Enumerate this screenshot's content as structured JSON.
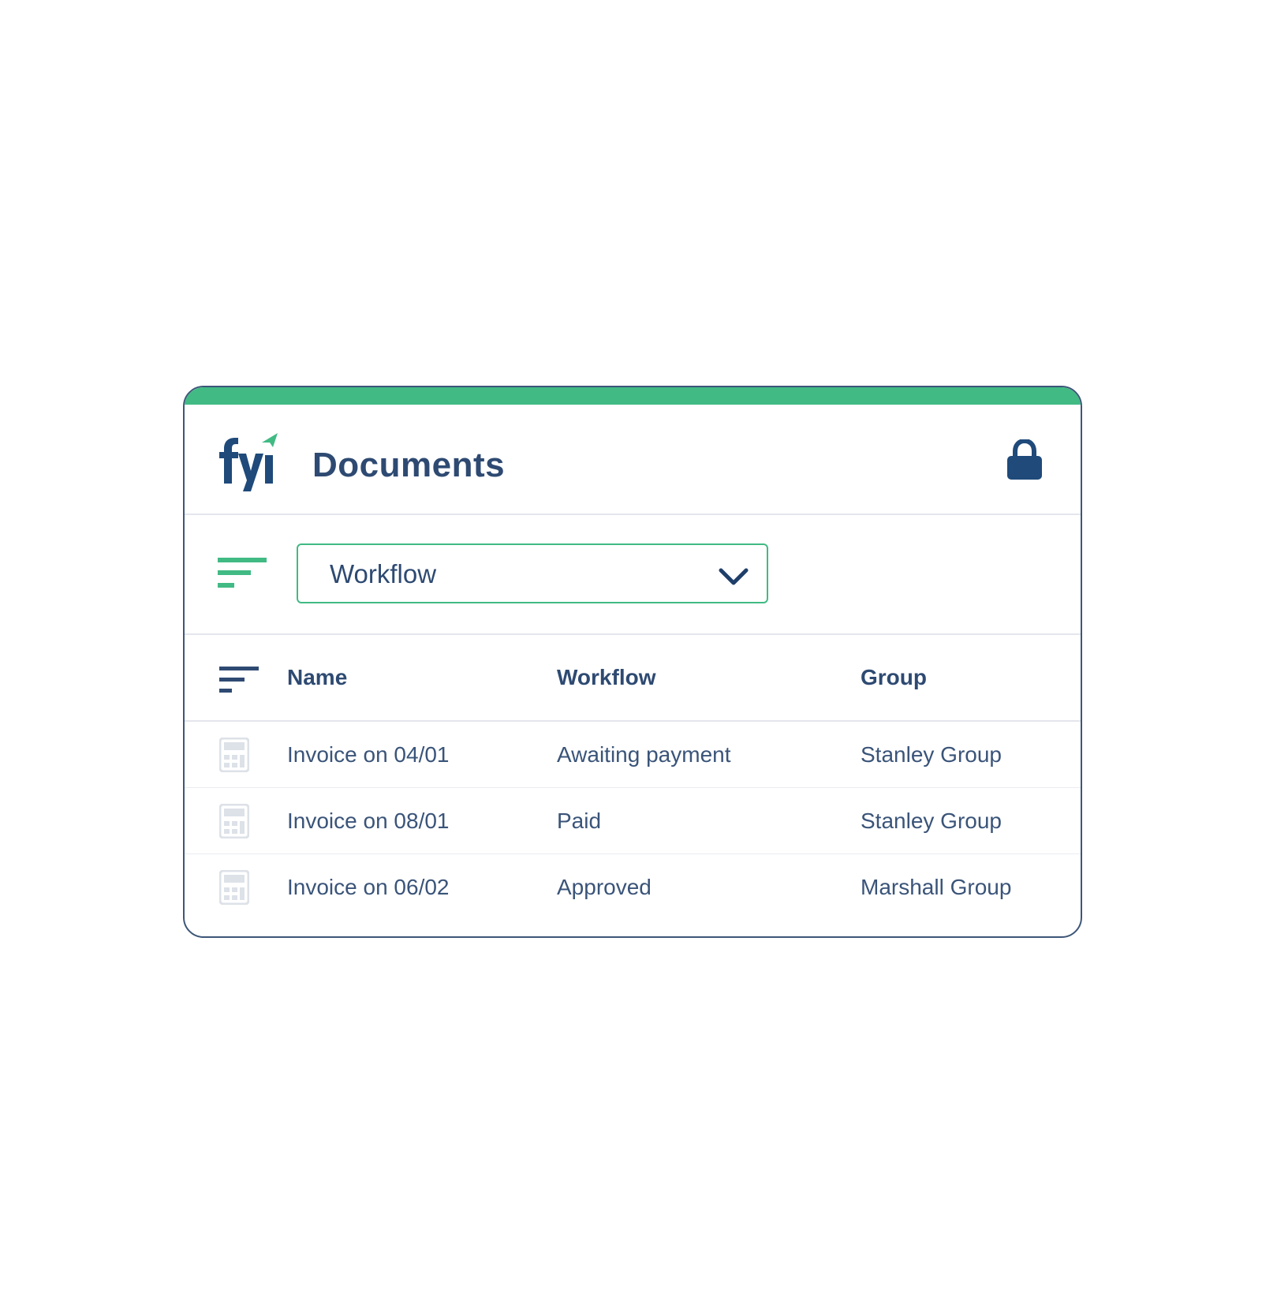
{
  "header": {
    "title": "Documents",
    "logo_icon": "fyi-logo",
    "lock_icon": "lock-icon"
  },
  "filter": {
    "icon": "filter-icon",
    "selected_value": "Workflow",
    "chevron_icon": "chevron-down-icon"
  },
  "table": {
    "sort_icon": "sort-icon",
    "columns": [
      "Name",
      "Workflow",
      "Group"
    ],
    "rows": [
      {
        "icon": "calculator-icon",
        "name": "Invoice on 04/01",
        "workflow": "Awaiting payment",
        "group": "Stanley Group"
      },
      {
        "icon": "calculator-icon",
        "name": "Invoice on 08/01",
        "workflow": "Paid",
        "group": "Stanley Group"
      },
      {
        "icon": "calculator-icon",
        "name": "Invoice on 06/02",
        "workflow": "Approved",
        "group": "Marshall Group"
      }
    ]
  },
  "colors": {
    "accent_green": "#41ba84",
    "navy": "#2e4a72",
    "card_border": "#3d5678",
    "divider": "#e3e6ec",
    "row_icon": "#dde1e8"
  }
}
